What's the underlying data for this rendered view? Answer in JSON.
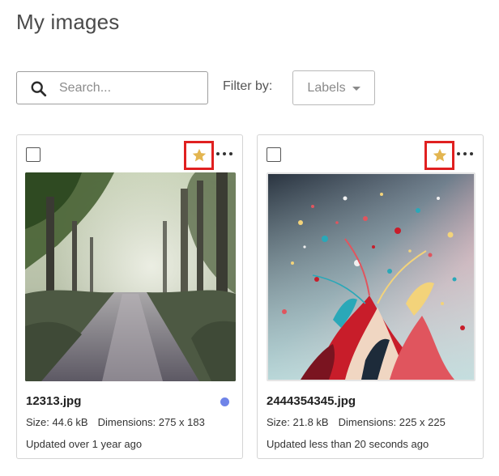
{
  "page": {
    "title": "My images"
  },
  "search": {
    "placeholder": "Search...",
    "value": ""
  },
  "filter": {
    "label": "Filter by:",
    "dropdown_label": "Labels"
  },
  "colors": {
    "star": "#e3b550",
    "highlight": "#e02020",
    "status_dot": "#6f84e8"
  },
  "cards": [
    {
      "name": "12313.jpg",
      "size_text": "Size: 44.6 kB",
      "dimensions_text": "Dimensions: 275 x 183",
      "updated_text": "Updated over 1 year ago",
      "starred": true,
      "has_status_dot": true,
      "image": "forest-path"
    },
    {
      "name": "2444354345.jpg",
      "size_text": "Size: 21.8 kB",
      "dimensions_text": "Dimensions: 225 x 225",
      "updated_text": "Updated less than 20 seconds ago",
      "starred": true,
      "has_status_dot": false,
      "image": "paint-splash"
    }
  ]
}
